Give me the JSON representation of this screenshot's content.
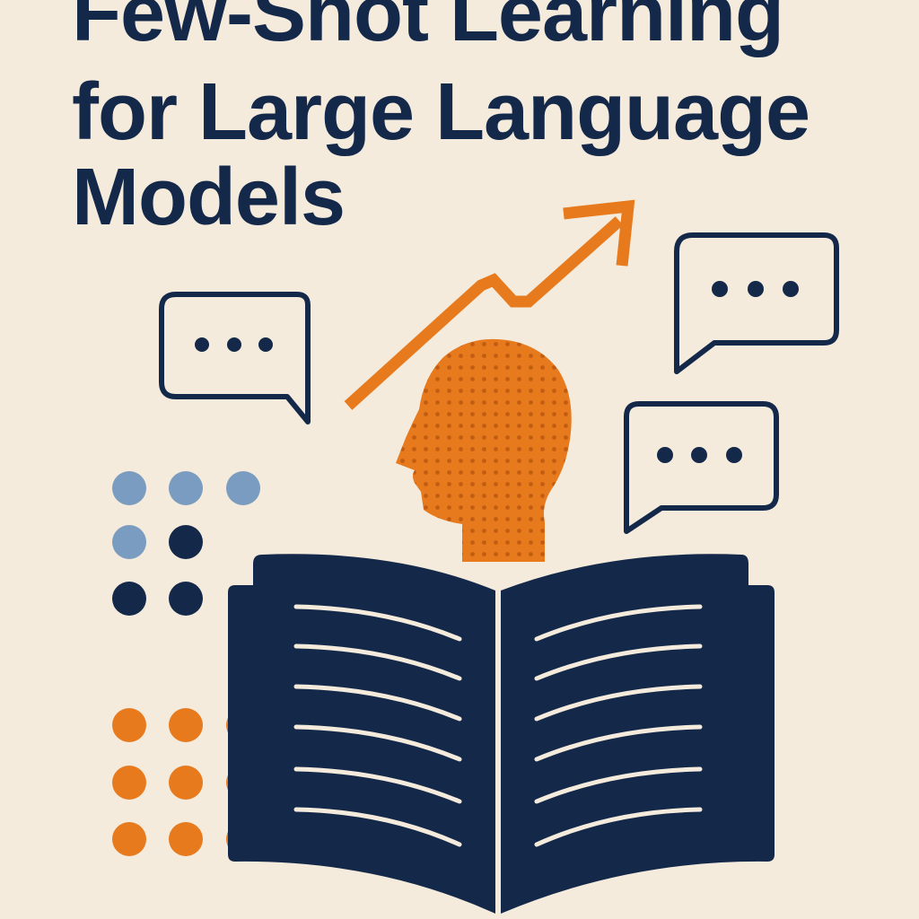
{
  "title": {
    "lines": [
      "Few-Shot Learning",
      "for Large Language",
      "Models"
    ]
  },
  "colors": {
    "background": "#f4ebdc",
    "navy": "#14294a",
    "orange": "#e87a1e",
    "steel_blue": "#7a9cc0",
    "page_line": "#f4ebdc"
  },
  "icons": [
    "upward-trend-arrow-icon",
    "speech-bubble-icon",
    "head-silhouette-icon",
    "open-book-icon",
    "dot-grid-icon"
  ]
}
